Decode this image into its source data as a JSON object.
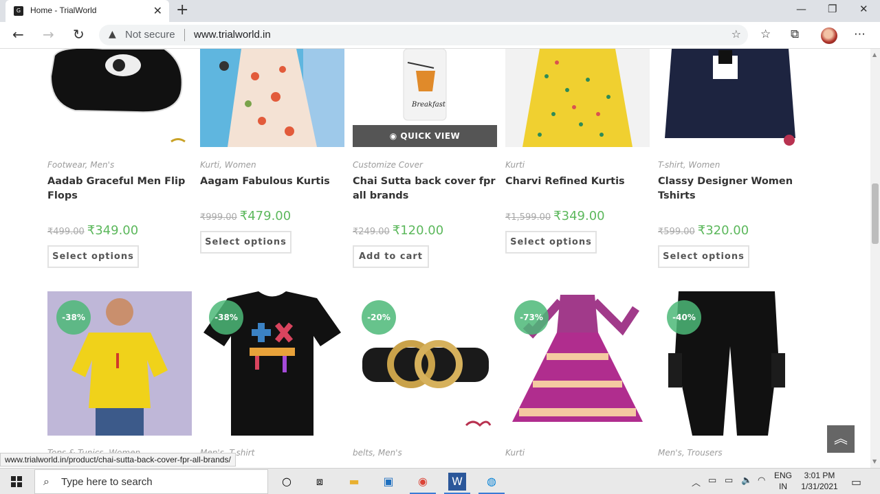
{
  "browser": {
    "tab_title": "Home - TrialWorld",
    "tab_close": "✕",
    "new_tab": "+",
    "security_label": "Not secure",
    "url": "www.trialworld.in",
    "status_url": "www.trialworld.in/product/chai-sutta-back-cover-fpr-all-brands/"
  },
  "row1": [
    {
      "category": "Footwear, Men's",
      "name": "Aadab Graceful Men Flip Flops",
      "old_price": "₹499.00",
      "price": "₹349.00",
      "button": "Select options"
    },
    {
      "category": "Kurti, Women",
      "name": "Aagam Fabulous Kurtis",
      "old_price": "₹999.00",
      "price": "₹479.00",
      "button": "Select options"
    },
    {
      "category": "Customize Cover",
      "name": "Chai Sutta back cover fpr all brands",
      "old_price": "₹249.00",
      "price": "₹120.00",
      "button": "Add to cart",
      "quick_view": "QUICK VIEW",
      "cover_text": "Breakfast"
    },
    {
      "category": "Kurti",
      "name": "Charvi Refined Kurtis",
      "old_price": "₹1,599.00",
      "price": "₹349.00",
      "button": "Select options"
    },
    {
      "category": "T-shirt, Women",
      "name": "Classy Designer Women Tshirts",
      "old_price": "₹599.00",
      "price": "₹320.00",
      "button": "Select options"
    }
  ],
  "row2": [
    {
      "badge": "-38%",
      "category": "Tops & Tunics, Women"
    },
    {
      "badge": "-38%",
      "category": "Men's, T-shirt"
    },
    {
      "badge": "-20%",
      "category": "belts, Men's"
    },
    {
      "badge": "-73%",
      "category": "Kurti"
    },
    {
      "badge": "-40%",
      "category": "Men's, Trousers"
    }
  ],
  "taskbar": {
    "search_placeholder": "Type here to search",
    "lang_line1": "ENG",
    "lang_line2": "IN",
    "time": "3:01 PM",
    "date": "1/31/2021"
  },
  "colors": {
    "sale_green": "#5cb85c",
    "badge_green": "#4cb978"
  }
}
